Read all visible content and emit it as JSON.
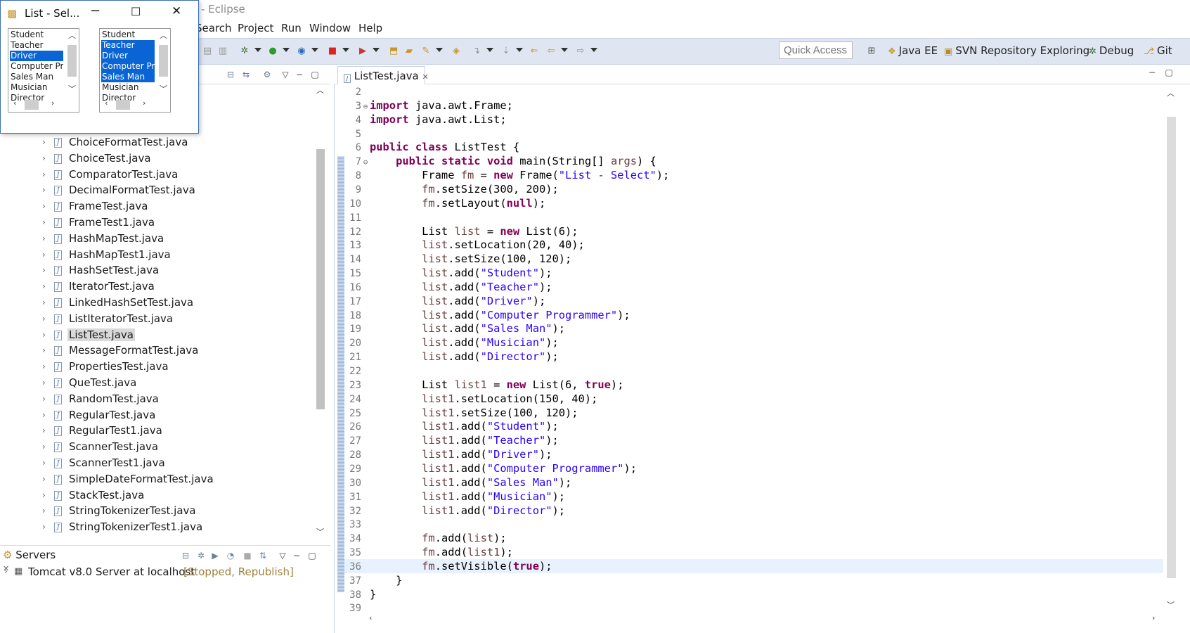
{
  "app_title": "a - Eclipse",
  "menu": [
    "Search",
    "Project",
    "Run",
    "Window",
    "Help"
  ],
  "quick_access_placeholder": "Quick Access",
  "perspectives": [
    "Java EE",
    "SVN Repository Exploring",
    "Debug",
    "Git"
  ],
  "popup": {
    "title": "List - Sel...",
    "list1": {
      "items": [
        "Student",
        "Teacher",
        "Driver",
        "Computer Pro",
        "Sales Man",
        "Musician",
        "Director"
      ],
      "selected": [
        2
      ]
    },
    "list2": {
      "items": [
        "Student",
        "Teacher",
        "Driver",
        "Computer Pro",
        "Sales Man",
        "Musician",
        "Director"
      ],
      "selected": [
        1,
        2,
        3,
        4
      ]
    }
  },
  "package_explorer": {
    "files": [
      "ChoiceFormatTest.java",
      "ChoiceTest.java",
      "ComparatorTest.java",
      "DecimalFormatTest.java",
      "FrameTest.java",
      "FrameTest1.java",
      "HashMapTest.java",
      "HashMapTest1.java",
      "HashSetTest.java",
      "IteratorTest.java",
      "LinkedHashSetTest.java",
      "ListIteratorTest.java",
      "ListTest.java",
      "MessageFormatTest.java",
      "PropertiesTest.java",
      "QueTest.java",
      "RandomTest.java",
      "RegularTest.java",
      "RegularTest1.java",
      "ScannerTest.java",
      "ScannerTest1.java",
      "SimpleDateFormatTest.java",
      "StackTest.java",
      "StringTokenizerTest.java",
      "StringTokenizerTest1.java"
    ],
    "selected": "ListTest.java"
  },
  "servers": {
    "tab_label": "Servers",
    "server_name": "Tomcat v8.0 Server at localhost",
    "server_status": "[Stopped, Republish]"
  },
  "editor": {
    "tab_label": "ListTest.java",
    "current_line": 36,
    "lines": [
      {
        "n": "2",
        "fold": "",
        "code": ""
      },
      {
        "n": "3",
        "fold": "⊖",
        "code": "[[kw:import]] java.awt.Frame;"
      },
      {
        "n": "4",
        "fold": "",
        "code": "[[kw:import]] java.awt.List;"
      },
      {
        "n": "5",
        "fold": "",
        "code": ""
      },
      {
        "n": "6",
        "fold": "",
        "code": "[[kw:public]] [[kw:class]] ListTest {"
      },
      {
        "n": "7",
        "fold": "⊖",
        "code": "    [[kw:public]] [[kw:static]] [[kw:void]] main(String[] [[fld:args]]) {"
      },
      {
        "n": "8",
        "fold": "",
        "code": "        Frame [[fld:fm]] = [[kw:new]] Frame([[str:\"List - Select\"]]);"
      },
      {
        "n": "9",
        "fold": "",
        "code": "        [[fld:fm]].setSize(300, 200);"
      },
      {
        "n": "10",
        "fold": "",
        "code": "        [[fld:fm]].setLayout([[kw:null]]);"
      },
      {
        "n": "11",
        "fold": "",
        "code": ""
      },
      {
        "n": "12",
        "fold": "",
        "code": "        List [[fld:list]] = [[kw:new]] List(6);"
      },
      {
        "n": "13",
        "fold": "",
        "code": "        [[fld:list]].setLocation(20, 40);"
      },
      {
        "n": "14",
        "fold": "",
        "code": "        [[fld:list]].setSize(100, 120);"
      },
      {
        "n": "15",
        "fold": "",
        "code": "        [[fld:list]].add([[str:\"Student\"]]);"
      },
      {
        "n": "16",
        "fold": "",
        "code": "        [[fld:list]].add([[str:\"Teacher\"]]);"
      },
      {
        "n": "17",
        "fold": "",
        "code": "        [[fld:list]].add([[str:\"Driver\"]]);"
      },
      {
        "n": "18",
        "fold": "",
        "code": "        [[fld:list]].add([[str:\"Computer Programmer\"]]);"
      },
      {
        "n": "19",
        "fold": "",
        "code": "        [[fld:list]].add([[str:\"Sales Man\"]]);"
      },
      {
        "n": "20",
        "fold": "",
        "code": "        [[fld:list]].add([[str:\"Musician\"]]);"
      },
      {
        "n": "21",
        "fold": "",
        "code": "        [[fld:list]].add([[str:\"Director\"]]);"
      },
      {
        "n": "22",
        "fold": "",
        "code": ""
      },
      {
        "n": "23",
        "fold": "",
        "code": "        List [[fld:list1]] = [[kw:new]] List(6, [[kw:true]]);"
      },
      {
        "n": "24",
        "fold": "",
        "code": "        [[fld:list1]].setLocation(150, 40);"
      },
      {
        "n": "25",
        "fold": "",
        "code": "        [[fld:list1]].setSize(100, 120);"
      },
      {
        "n": "26",
        "fold": "",
        "code": "        [[fld:list1]].add([[str:\"Student\"]]);"
      },
      {
        "n": "27",
        "fold": "",
        "code": "        [[fld:list1]].add([[str:\"Teacher\"]]);"
      },
      {
        "n": "28",
        "fold": "",
        "code": "        [[fld:list1]].add([[str:\"Driver\"]]);"
      },
      {
        "n": "29",
        "fold": "",
        "code": "        [[fld:list1]].add([[str:\"Computer Programmer\"]]);"
      },
      {
        "n": "30",
        "fold": "",
        "code": "        [[fld:list1]].add([[str:\"Sales Man\"]]);"
      },
      {
        "n": "31",
        "fold": "",
        "code": "        [[fld:list1]].add([[str:\"Musician\"]]);"
      },
      {
        "n": "32",
        "fold": "",
        "code": "        [[fld:list1]].add([[str:\"Director\"]]);"
      },
      {
        "n": "33",
        "fold": "",
        "code": ""
      },
      {
        "n": "34",
        "fold": "",
        "code": "        [[fld:fm]].add([[fld:list]]);"
      },
      {
        "n": "35",
        "fold": "",
        "code": "        [[fld:fm]].add([[fld:list1]]);"
      },
      {
        "n": "36",
        "fold": "",
        "code": "        [[fld:fm]].setVisible([[kw:true]]);"
      },
      {
        "n": "37",
        "fold": "",
        "code": "    }"
      },
      {
        "n": "38",
        "fold": "",
        "code": "}"
      },
      {
        "n": "39",
        "fold": "",
        "code": ""
      }
    ]
  },
  "colors": {
    "keyword": "#7f0055",
    "string": "#2a00ff",
    "field": "#6a3e3e",
    "selection": "#0a64d4",
    "toolbar": "#dfe6f1"
  }
}
